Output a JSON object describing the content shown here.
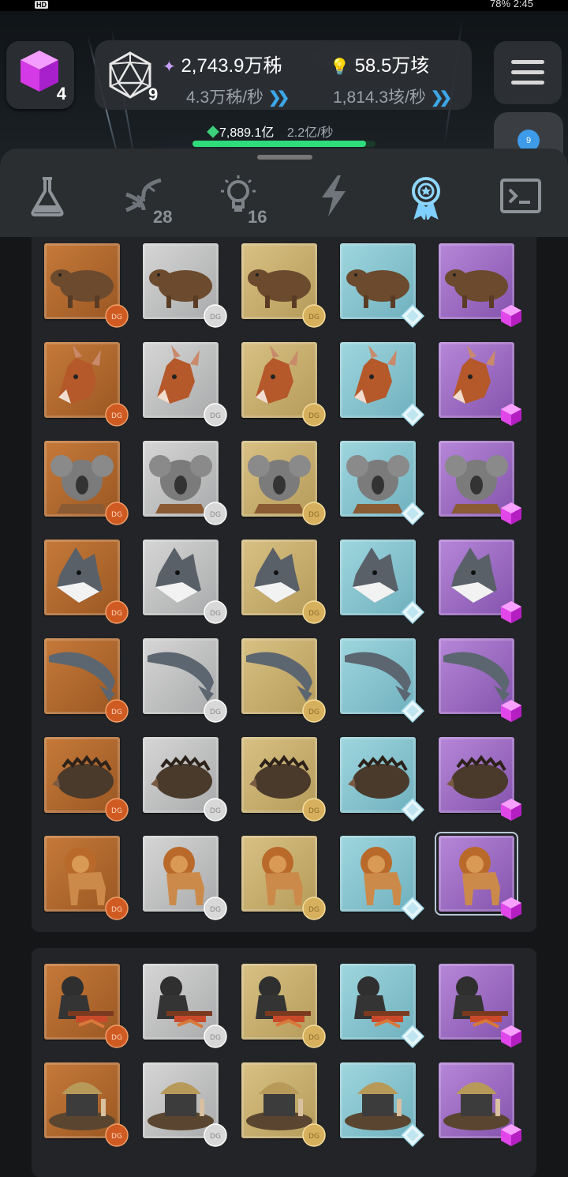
{
  "status_bar": {
    "left_text": "HD",
    "right_text": "78%   2:45"
  },
  "header": {
    "cube_count": "4",
    "d20_count": "9",
    "resource_1": {
      "amount": "2,743.9万秭",
      "rate": "4.3万秭/秒"
    },
    "resource_2": {
      "amount": "58.5万垓",
      "rate": "1,814.3垓/秒"
    },
    "resource_3": {
      "amount": "7,889.1亿",
      "rate": "2.2亿/秒",
      "progress": 0.95
    },
    "orbs": {
      "count": "9"
    }
  },
  "tabs": [
    {
      "name": "science-tab",
      "icon": "flask-icon",
      "count": ""
    },
    {
      "name": "dna-tab",
      "icon": "dna-icon",
      "count": "28"
    },
    {
      "name": "ideas-tab",
      "icon": "lightbulb-icon",
      "count": "16"
    },
    {
      "name": "energy-tab",
      "icon": "lightning-icon",
      "count": ""
    },
    {
      "name": "achievements-tab",
      "icon": "medal-icon",
      "count": "",
      "active": true
    },
    {
      "name": "console-tab",
      "icon": "terminal-icon",
      "count": ""
    }
  ],
  "tiers": [
    "bronze",
    "silver",
    "gold",
    "diamond",
    "purple"
  ],
  "grid_1_rows": [
    "capybara",
    "deer",
    "koala",
    "wolf",
    "whale",
    "hedgehog",
    "lion"
  ],
  "grid_2_rows": [
    "chimpanzee",
    "hut"
  ],
  "selected_card": {
    "row": "lion",
    "tier": "purple"
  }
}
